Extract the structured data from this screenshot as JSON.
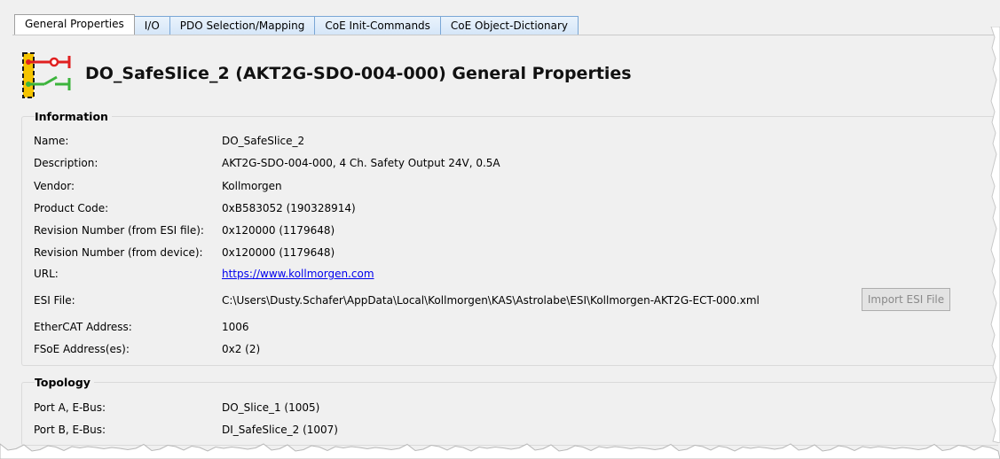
{
  "tabs": [
    {
      "label": "General Properties",
      "active": true
    },
    {
      "label": "I/O",
      "active": false
    },
    {
      "label": "PDO Selection/Mapping",
      "active": false
    },
    {
      "label": "CoE Init-Commands",
      "active": false
    },
    {
      "label": "CoE Object-Dictionary",
      "active": false
    }
  ],
  "header": {
    "title": "DO_SafeSlice_2 (AKT2G-SDO-004-000) General Properties",
    "icon": "safety-output-module-icon"
  },
  "information": {
    "title": "Information",
    "rows": [
      {
        "label": "Name:",
        "value": "DO_SafeSlice_2"
      },
      {
        "label": "Description:",
        "value": "AKT2G-SDO-004-000, 4 Ch. Safety Output 24V, 0.5A"
      },
      {
        "label": "Vendor:",
        "value": "Kollmorgen"
      },
      {
        "label": "Product Code:",
        "value": "0xB583052 (190328914)"
      },
      {
        "label": "Revision Number (from ESI file):",
        "value": "0x120000 (1179648)"
      },
      {
        "label": "Revision Number (from device):",
        "value": "0x120000 (1179648)"
      },
      {
        "label": "URL:",
        "value": "https://www.kollmorgen.com"
      },
      {
        "label": "ESI File:",
        "value": "C:\\Users\\Dusty.Schafer\\AppData\\Local\\Kollmorgen\\KAS\\Astrolabe\\ESI\\Kollmorgen-AKT2G-ECT-000.xml"
      },
      {
        "label": "EtherCAT Address:",
        "value": "1006"
      },
      {
        "label": "FSoE Address(es):",
        "value": "0x2 (2)"
      }
    ],
    "import_button": "Import ESI File"
  },
  "topology": {
    "title": "Topology",
    "rows": [
      {
        "label": "Port A, E-Bus:",
        "value": "DO_Slice_1 (1005)"
      },
      {
        "label": "Port B, E-Bus:",
        "value": "DI_SafeSlice_2 (1007)"
      }
    ]
  },
  "colors": {
    "tab_border": "#7aa7d6",
    "link": "#0000ee",
    "icon_yellow": "#f5c400",
    "icon_red": "#e02020",
    "icon_green": "#3cb43c"
  }
}
